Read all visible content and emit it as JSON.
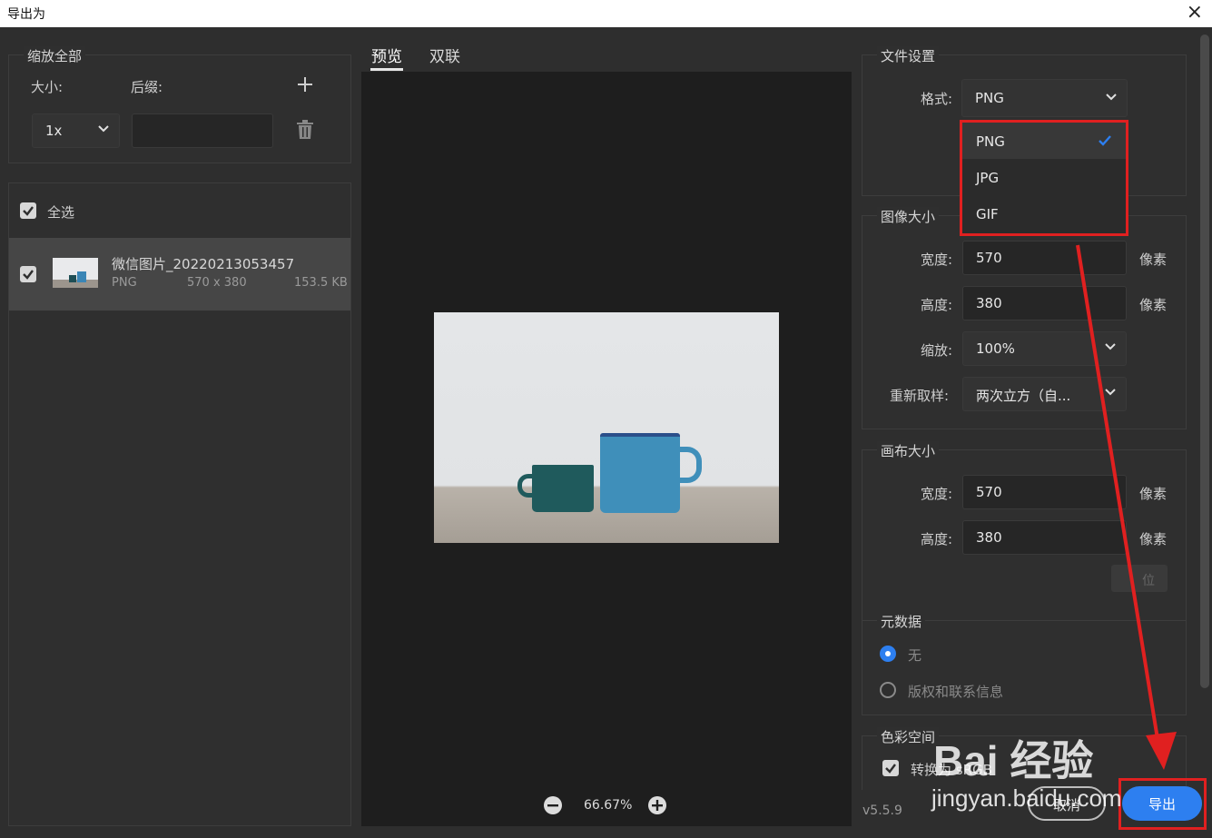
{
  "window": {
    "title": "导出为",
    "close_glyph": "×",
    "version": "v5.5.9"
  },
  "scale_all": {
    "legend": "缩放全部",
    "size_label": "大小:",
    "suffix_label": "后缀:",
    "size_value": "1x",
    "suffix_value": "",
    "add_icon": "plus-icon",
    "delete_icon": "trash-icon"
  },
  "asset_list": {
    "select_all_label": "全选",
    "items": [
      {
        "name": "微信图片_20220213053457",
        "format": "PNG",
        "dimensions": "570 x 380",
        "size": "153.5 KB",
        "checked": true
      }
    ]
  },
  "preview": {
    "tabs": [
      "预览",
      "双联"
    ],
    "active_tab": 0,
    "zoom": "66.67%"
  },
  "file_settings": {
    "legend": "文件设置",
    "format_label": "格式:",
    "format_value": "PNG",
    "dropdown_options": [
      "PNG",
      "JPG",
      "GIF"
    ],
    "selected_option": "PNG"
  },
  "image_size": {
    "legend": "图像大小",
    "width_label": "宽度:",
    "width_value": "570",
    "height_label": "高度:",
    "height_value": "380",
    "unit": "像素",
    "scale_label": "缩放:",
    "scale_value": "100%",
    "resample_label": "重新取样:",
    "resample_value": "两次立方（自..."
  },
  "canvas_size": {
    "legend": "画布大小",
    "width_label": "宽度:",
    "width_value": "570",
    "height_label": "高度:",
    "height_value": "380",
    "unit": "像素",
    "reset_label": "位"
  },
  "metadata": {
    "legend": "元数据",
    "options": [
      "无",
      "版权和联系信息"
    ],
    "selected": 0
  },
  "color_space": {
    "legend": "色彩空间",
    "convert_label": "转换为 sRGB"
  },
  "actions": {
    "cancel": "取消",
    "export": "导出"
  },
  "watermark": {
    "brand": "Bai 经验",
    "url": "jingyan.baidu.com"
  },
  "colors": {
    "accent": "#2d7ff0",
    "annotation": "#e02020",
    "stage": "#1e1e1e",
    "panel": "#2f2f2f"
  }
}
